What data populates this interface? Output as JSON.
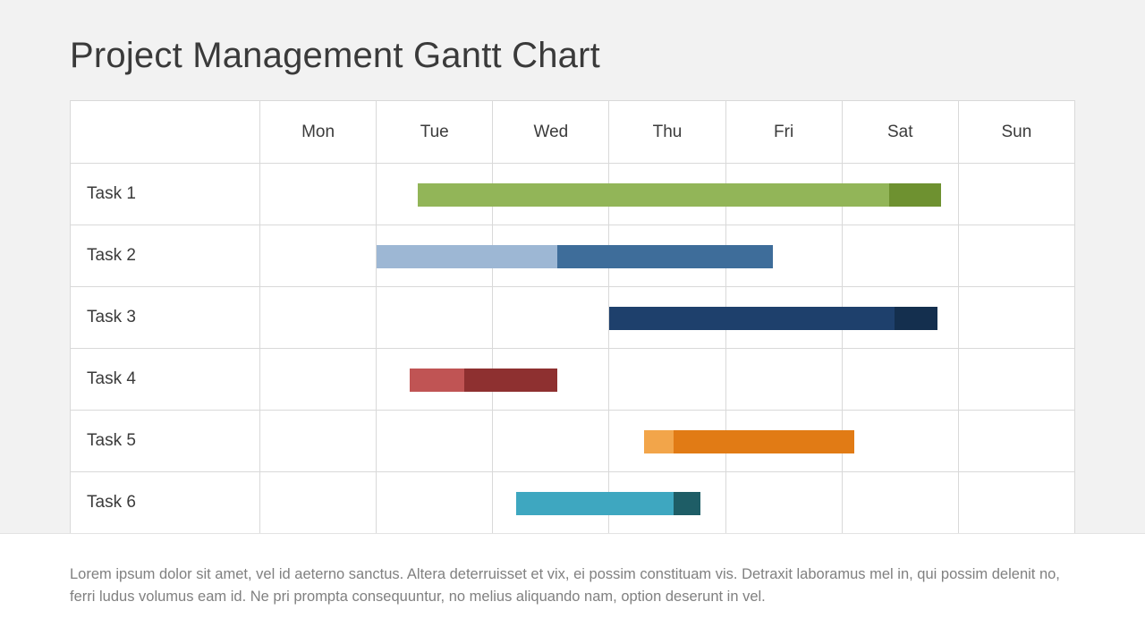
{
  "title": "Project Management Gantt Chart",
  "days": [
    "Mon",
    "Tue",
    "Wed",
    "Thu",
    "Fri",
    "Sat",
    "Sun"
  ],
  "tasks": [
    {
      "label": "Task 1"
    },
    {
      "label": "Task 2"
    },
    {
      "label": "Task 3"
    },
    {
      "label": "Task 4"
    },
    {
      "label": "Task 5"
    },
    {
      "label": "Task 6"
    }
  ],
  "footer_text": "Lorem ipsum dolor sit amet, vel id aeterno sanctus. Altera deterruisset et vix, ei possim constituam vis. Detraxit laboramus mel in, qui possim delenit no, ferri ludus volumus eam id. Ne pri prompta consequuntur, no melius aliquando nam, option deserunt in vel.",
  "chart_data": {
    "type": "gantt",
    "title": "Project Management Gantt Chart",
    "categories": [
      "Mon",
      "Tue",
      "Wed",
      "Thu",
      "Fri",
      "Sat",
      "Sun"
    ],
    "x_unit": "day_index_0_to_7",
    "series": [
      {
        "name": "Task 1",
        "segments": [
          {
            "start": 1.35,
            "end": 5.4,
            "color": "#92B558"
          },
          {
            "start": 5.4,
            "end": 5.85,
            "color": "#6E9130"
          }
        ]
      },
      {
        "name": "Task 2",
        "segments": [
          {
            "start": 1.0,
            "end": 2.55,
            "color": "#9DB7D4"
          },
          {
            "start": 2.55,
            "end": 4.4,
            "color": "#3E6D9A"
          }
        ]
      },
      {
        "name": "Task 3",
        "segments": [
          {
            "start": 3.0,
            "end": 5.45,
            "color": "#1E406C"
          },
          {
            "start": 5.45,
            "end": 5.82,
            "color": "#142F4E"
          }
        ]
      },
      {
        "name": "Task 4",
        "segments": [
          {
            "start": 1.28,
            "end": 1.75,
            "color": "#C05454"
          },
          {
            "start": 1.75,
            "end": 2.55,
            "color": "#8E3030"
          }
        ]
      },
      {
        "name": "Task 5",
        "segments": [
          {
            "start": 3.3,
            "end": 3.55,
            "color": "#F2A54A"
          },
          {
            "start": 3.55,
            "end": 5.1,
            "color": "#E17B15"
          }
        ]
      },
      {
        "name": "Task 6",
        "segments": [
          {
            "start": 2.2,
            "end": 3.55,
            "color": "#3EA7C0"
          },
          {
            "start": 3.55,
            "end": 3.78,
            "color": "#1E5D66"
          }
        ]
      }
    ]
  }
}
